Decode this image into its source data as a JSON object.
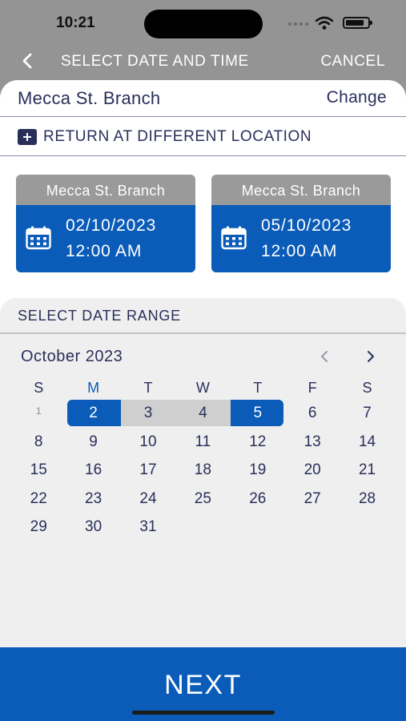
{
  "status_bar": {
    "time": "10:21"
  },
  "nav": {
    "title": "SELECT DATE AND TIME",
    "cancel_label": "CANCEL"
  },
  "branch": {
    "name": "Mecca St. Branch",
    "change_label": "Change"
  },
  "return_location": {
    "label": "RETURN AT DIFFERENT LOCATION"
  },
  "pickup": {
    "location": "Mecca St. Branch",
    "date": "02/10/2023",
    "time": "12:00 AM"
  },
  "dropoff": {
    "location": "Mecca St. Branch",
    "date": "05/10/2023",
    "time": "12:00 AM"
  },
  "calendar": {
    "section_title": "SELECT DATE RANGE",
    "month": "October 2023",
    "prev_icon": "chevron-left-icon",
    "next_icon": "chevron-right-icon",
    "weekdays": [
      "S",
      "M",
      "T",
      "W",
      "T",
      "F",
      "S"
    ],
    "highlighted_weekday": 1,
    "days": [
      "1",
      "2",
      "3",
      "4",
      "5",
      "6",
      "7",
      "8",
      "9",
      "10",
      "11",
      "12",
      "13",
      "14",
      "15",
      "16",
      "17",
      "18",
      "19",
      "20",
      "21",
      "22",
      "23",
      "24",
      "25",
      "26",
      "27",
      "28",
      "29",
      "30",
      "31"
    ],
    "muted_days": [
      "1"
    ],
    "range_start": "2",
    "range_end": "5",
    "selected_color": "#0a5cb8",
    "range_color": "#cfcfcf"
  },
  "footer": {
    "next_label": "NEXT"
  },
  "colors": {
    "accent": "#0a5cb8",
    "text": "#2a2f5a",
    "header_gray": "#949494"
  }
}
